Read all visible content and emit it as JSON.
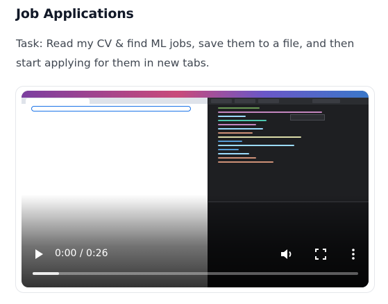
{
  "section": {
    "title": "Job Applications",
    "description": "Task: Read my CV & find ML jobs, save them to a file, and then start applying for them in new tabs."
  },
  "video": {
    "time_display": "0:00 / 0:26",
    "buffered_fraction": 0.08,
    "icons": {
      "play": "play-icon",
      "volume": "volume-icon",
      "fullscreen": "fullscreen-icon",
      "more": "more-vertical-icon"
    }
  }
}
